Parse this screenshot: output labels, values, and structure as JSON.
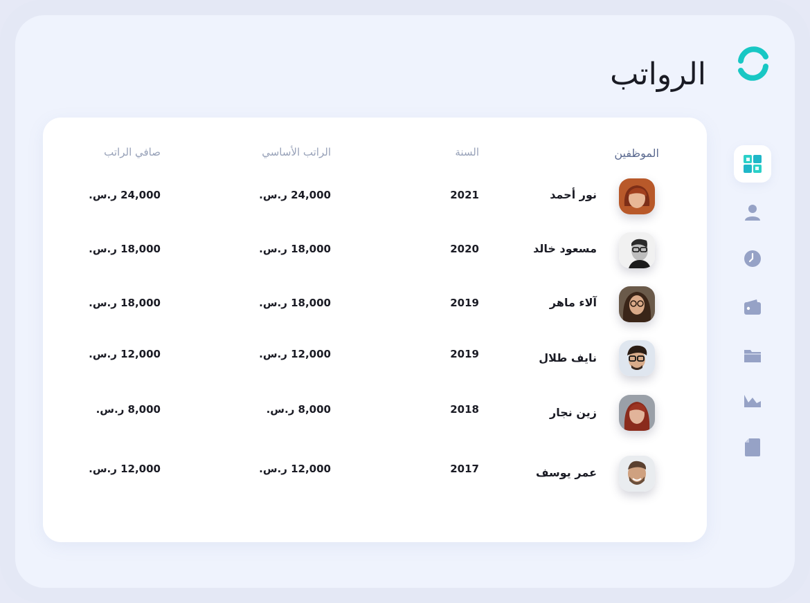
{
  "page": {
    "title": "الرواتب"
  },
  "colors": {
    "accent": "#18c7c4",
    "nav_icon": "#96a2c6",
    "nav_active_bg": "#ffffff"
  },
  "sidebar": {
    "items": [
      {
        "name": "dashboard",
        "icon": "grid-icon",
        "active": true
      },
      {
        "name": "employees",
        "icon": "user-icon",
        "active": false
      },
      {
        "name": "attendance",
        "icon": "clock-icon",
        "active": false
      },
      {
        "name": "finance",
        "icon": "wallet-icon",
        "active": false
      },
      {
        "name": "files",
        "icon": "folder-icon",
        "active": false
      },
      {
        "name": "reports",
        "icon": "area-chart-icon",
        "active": false
      },
      {
        "name": "documents",
        "icon": "document-icon",
        "active": false
      }
    ]
  },
  "table": {
    "headers": {
      "employee": "الموظفين",
      "year": "السنة",
      "basic_salary": "الراتب الأساسي",
      "net_salary": "صافي الراتب"
    },
    "rows": [
      {
        "name": "نور أحمد",
        "year": "2021",
        "basic": "24,000 ر.س.",
        "net": "24,000 ر.س."
      },
      {
        "name": "مسعود خالد",
        "year": "2020",
        "basic": "18,000 ر.س.",
        "net": "18,000 ر.س."
      },
      {
        "name": "آلاء ماهر",
        "year": "2019",
        "basic": "18,000 ر.س.",
        "net": "18,000 ر.س."
      },
      {
        "name": "نايف طلال",
        "year": "2019",
        "basic": "12,000 ر.س.",
        "net": "12,000 ر.س."
      },
      {
        "name": "زين نجار",
        "year": "2018",
        "basic": "8,000 ر.س.",
        "net": "8,000 ر.س."
      },
      {
        "name": "عمر يوسف",
        "year": "2017",
        "basic": "12,000 ر.س.",
        "net": "12,000 ر.س."
      }
    ]
  }
}
